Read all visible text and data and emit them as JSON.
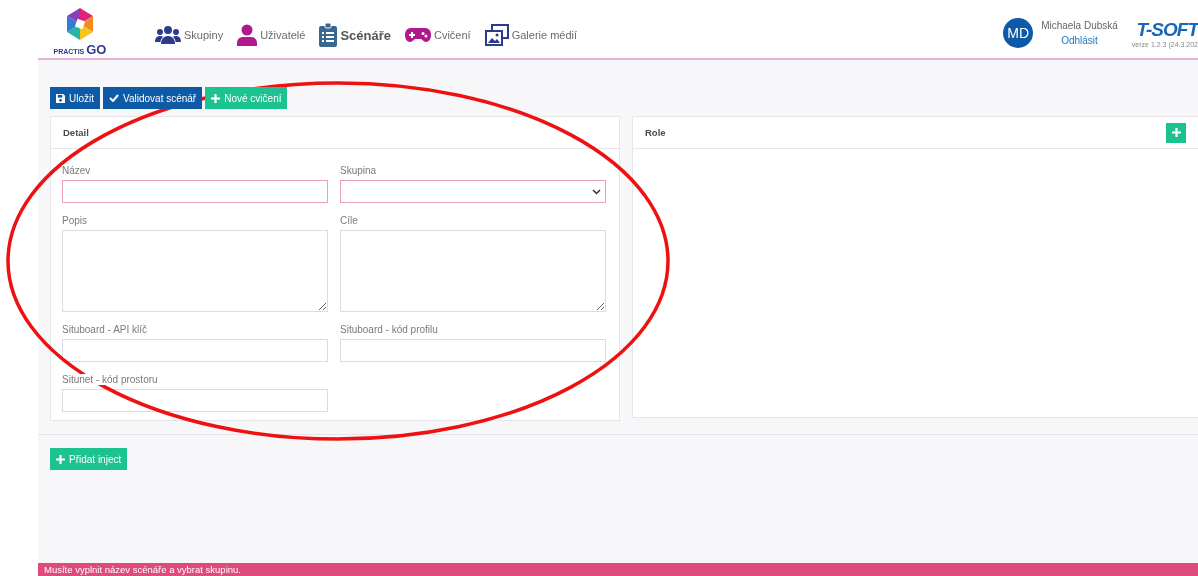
{
  "logo": {
    "brand": "PRACTIS",
    "suffix": "GO"
  },
  "nav": [
    {
      "label": "Skupiny",
      "selected": false
    },
    {
      "label": "Uživatelé",
      "selected": false
    },
    {
      "label": "Scénáře",
      "selected": true
    },
    {
      "label": "Cvičení",
      "selected": false
    },
    {
      "label": "Galerie médií",
      "selected": false
    }
  ],
  "user": {
    "initials": "MD",
    "name": "Michaela Dubská",
    "logout": "Odhlásit"
  },
  "vendor": {
    "logo": "T-SOFT",
    "version": "verze 1.2.3 (24.3.202"
  },
  "toolbar": [
    {
      "label": "Uložit",
      "kind": "primary"
    },
    {
      "label": "Validovat scénář",
      "kind": "primary"
    },
    {
      "label": "Nové cvičení",
      "kind": "success"
    }
  ],
  "detail": {
    "title": "Detail",
    "fields": [
      {
        "label": "Název",
        "kind": "input",
        "invalid": true
      },
      {
        "label": "Skupina",
        "kind": "select",
        "invalid": true
      },
      {
        "label": "Popis",
        "kind": "textarea",
        "invalid": false
      },
      {
        "label": "Cíle",
        "kind": "textarea",
        "invalid": false
      },
      {
        "label": "Situboard - API klíč",
        "kind": "input",
        "invalid": false
      },
      {
        "label": "Situboard - kód profilu",
        "kind": "input",
        "invalid": false
      },
      {
        "label": "Situnet - kód prostoru",
        "kind": "input",
        "invalid": false
      }
    ]
  },
  "role": {
    "title": "Role"
  },
  "add_inject": {
    "label": "Přidat inject"
  },
  "status_bar": {
    "message": "Musíte vyplnit název scénáře a vybrat skupinu.",
    "kind": "error"
  },
  "annotation": {
    "kind": "ellipse"
  }
}
